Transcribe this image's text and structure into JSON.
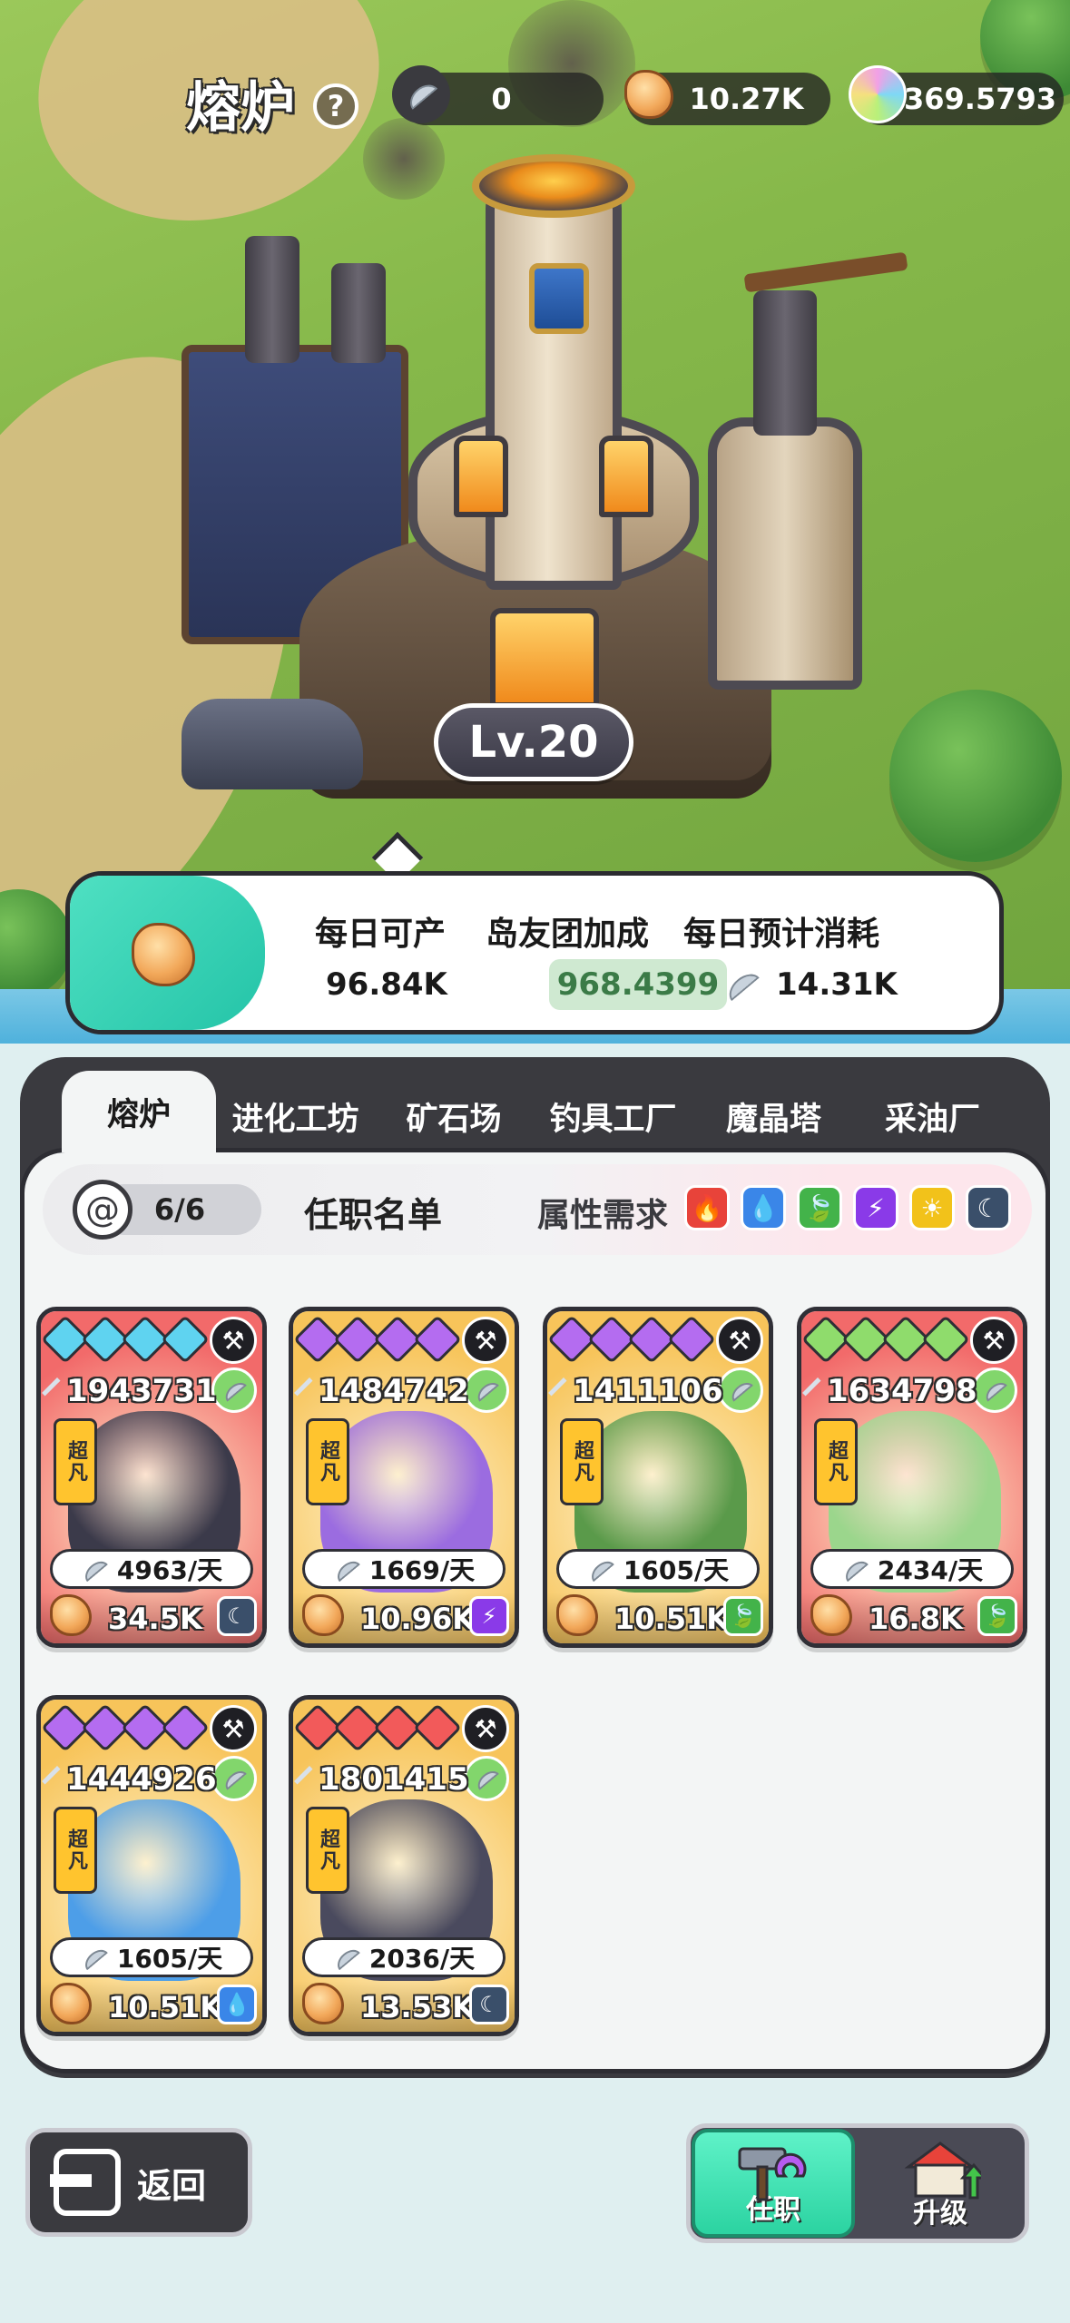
{
  "header": {
    "title": "熔炉",
    "help_label": "?",
    "resources": [
      {
        "name": "feather",
        "value": "0"
      },
      {
        "name": "ore",
        "value": "10.27K"
      },
      {
        "name": "gem",
        "value": "369.5793"
      }
    ]
  },
  "building": {
    "level": "Lv.20"
  },
  "production": {
    "daily_output_label": "每日可产",
    "daily_output_value": "96.84K",
    "team_bonus_label": "岛友团加成",
    "team_bonus_value": "968.4399",
    "daily_cost_label": "每日预计消耗",
    "daily_cost_value": "14.31K"
  },
  "tabs": [
    "熔炉",
    "进化工坊",
    "矿石场",
    "钓具工厂",
    "魔晶塔",
    "采油厂"
  ],
  "active_tab": "熔炉",
  "roster": {
    "slots": "6/6",
    "title": "任职名单",
    "requirement_label": "属性需求",
    "elements": [
      {
        "name": "fire",
        "glyph": "🔥",
        "color": "#e8433a"
      },
      {
        "name": "water",
        "glyph": "💧",
        "color": "#3a86e8"
      },
      {
        "name": "leaf",
        "glyph": "🍃",
        "color": "#43b34a"
      },
      {
        "name": "lightning",
        "glyph": "⚡",
        "color": "#8a3ae8"
      },
      {
        "name": "sun",
        "glyph": "☀",
        "color": "#f2c21a"
      },
      {
        "name": "moon",
        "glyph": "☾",
        "color": "#3a4f6a"
      }
    ]
  },
  "cards": [
    {
      "power": "1943731",
      "rarity": "超凡",
      "rate": "4963/天",
      "yield": "34.5K",
      "star_color": "#5fd3f0",
      "bg": "#f26a6a",
      "creature": "#3b3a4a",
      "attr_color": "#3a4f6a",
      "attr_glyph": "☾"
    },
    {
      "power": "1484742",
      "rarity": "超凡",
      "rate": "1669/天",
      "yield": "10.96K",
      "star_color": "#b46cf0",
      "bg": "#f7c45a",
      "creature": "#9b6ce0",
      "attr_color": "#8a3ae8",
      "attr_glyph": "⚡"
    },
    {
      "power": "1411106",
      "rarity": "超凡",
      "rate": "1605/天",
      "yield": "10.51K",
      "star_color": "#b46cf0",
      "bg": "#f7c45a",
      "creature": "#5a9a4a",
      "attr_color": "#43b34a",
      "attr_glyph": "🍃"
    },
    {
      "power": "1634798",
      "rarity": "超凡",
      "rate": "2434/天",
      "yield": "16.8K",
      "star_color": "#8fdc6c",
      "bg": "#f26a6a",
      "creature": "#9bd68c",
      "attr_color": "#43b34a",
      "attr_glyph": "🍃"
    },
    {
      "power": "1444926",
      "rarity": "超凡",
      "rate": "1605/天",
      "yield": "10.51K",
      "star_color": "#b46cf0",
      "bg": "#f7c45a",
      "creature": "#4d9ee8",
      "attr_color": "#3a86e8",
      "attr_glyph": "💧"
    },
    {
      "power": "1801415",
      "rarity": "超凡",
      "rate": "2036/天",
      "yield": "13.53K",
      "star_color": "#f25a5a",
      "bg": "#f7c45a",
      "creature": "#4a4a5e",
      "attr_color": "#3a4f6a",
      "attr_glyph": "☾"
    }
  ],
  "footer": {
    "back_label": "返回",
    "assign_label": "任职",
    "upgrade_label": "升级"
  }
}
